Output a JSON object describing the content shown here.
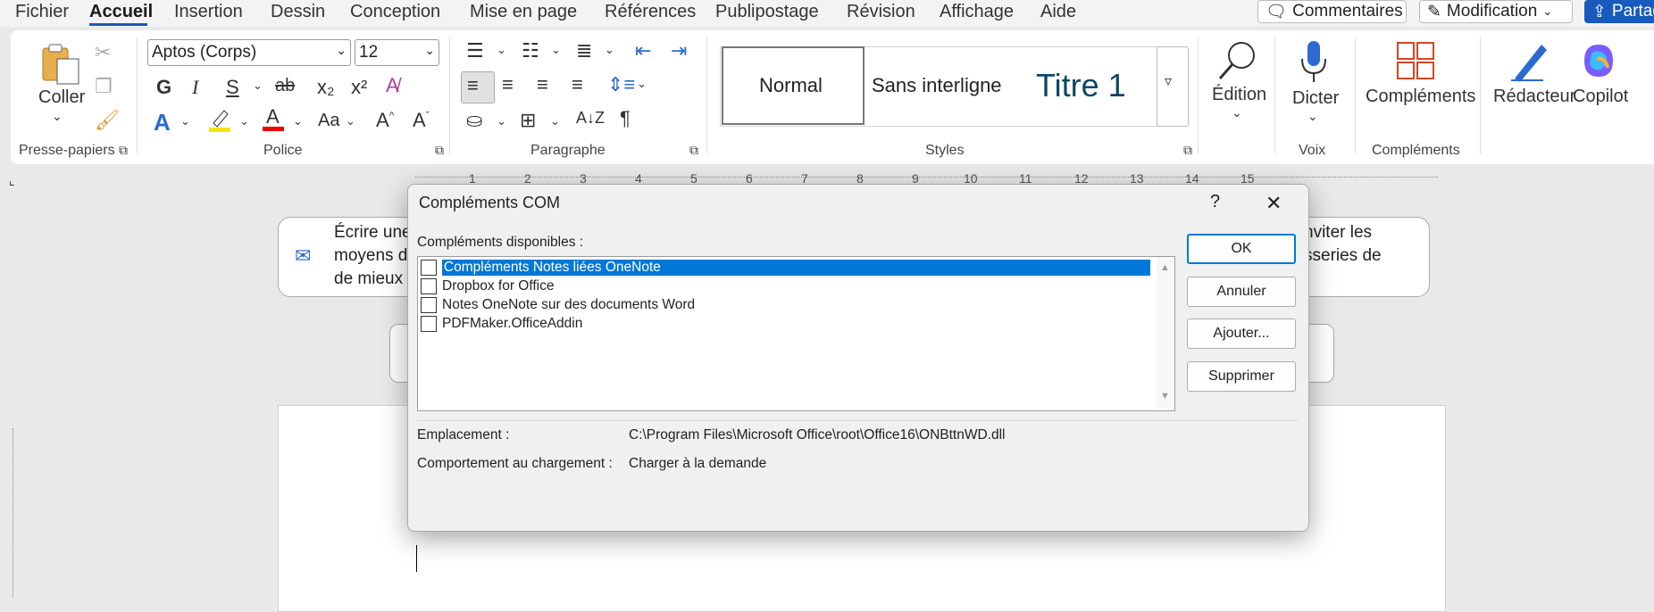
{
  "menubar": {
    "items": [
      "Fichier",
      "Accueil",
      "Insertion",
      "Dessin",
      "Conception",
      "Mise en page",
      "Références",
      "Publipostage",
      "Révision",
      "Affichage",
      "Aide"
    ],
    "comments": "Commentaires",
    "editing": "Modification",
    "share": "Partag"
  },
  "ribbon": {
    "clipboard": {
      "paste": "Coller",
      "label": "Presse-papiers"
    },
    "font": {
      "name": "Aptos (Corps)",
      "size": "12",
      "bold": "G",
      "italic": "I",
      "underline": "S",
      "strike": "ab",
      "sub": "x₂",
      "sup": "x²",
      "case": "Aa",
      "grow": "A^",
      "shrink": "Aˇ",
      "label": "Police"
    },
    "paragraph": {
      "label": "Paragraphe",
      "sort": "A↓Z",
      "pilcrow": "¶"
    },
    "styles": {
      "normal": "Normal",
      "nospacing": "Sans interligne",
      "title1": "Titre 1",
      "label": "Styles"
    },
    "editing": {
      "label": "Édition"
    },
    "voice": {
      "dictate": "Dicter",
      "label": "Voix"
    },
    "addins": {
      "btn": "Compléments",
      "label": "Compléments"
    },
    "editor": "Rédacteur",
    "copilot": "Copilot"
  },
  "ruler": {
    "numbers": [
      "1",
      "2",
      "3",
      "4",
      "5",
      "6",
      "7",
      "8",
      "9",
      "10",
      "11",
      "12",
      "13",
      "14",
      "15"
    ]
  },
  "doc": {
    "hint_line1": "Écrire une",
    "hint_line2": "moyens d",
    "hint_line3": "de mieux",
    "hint_right1": "nviter les",
    "hint_right2": "sseries de"
  },
  "dialog": {
    "title": "Compléments COM",
    "help": "?",
    "close": "✕",
    "available_label": "Compléments disponibles :",
    "items": [
      "Compléments Notes liées OneNote",
      "Dropbox for Office",
      "Notes OneNote sur des documents Word",
      "PDFMaker.OfficeAddin"
    ],
    "buttons": {
      "ok": "OK",
      "cancel": "Annuler",
      "add": "Ajouter...",
      "remove": "Supprimer"
    },
    "location_label": "Emplacement :",
    "location_value": "C:\\Program Files\\Microsoft Office\\root\\Office16\\ONBttnWD.dll",
    "behavior_label": "Comportement au chargement :",
    "behavior_value": "Charger à la demande"
  },
  "colors": {
    "accent": "#185abd",
    "selection": "#0078d7",
    "share_btn": "#185abd"
  }
}
